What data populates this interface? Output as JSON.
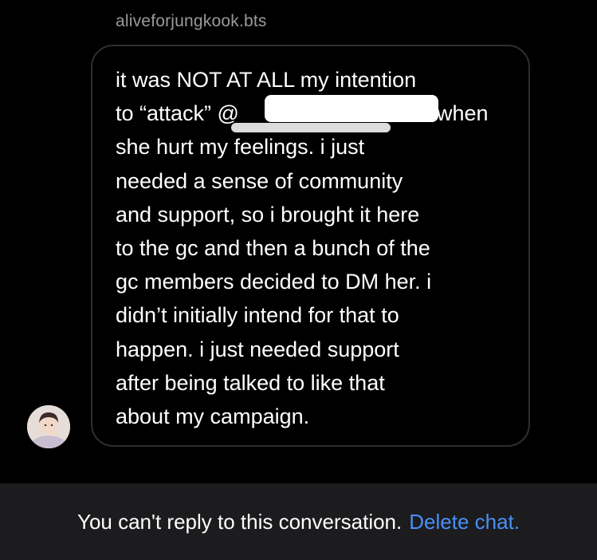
{
  "conversation": {
    "sender_name": "aliveforjungkook.bts"
  },
  "message": {
    "lines": [
      "it was NOT AT ALL my intention",
      "to “attack” @",
      "k when",
      "she hurt my feelings. i just",
      "needed a sense of community",
      "and support, so i brought it here",
      "to the gc and then a bunch of the",
      "gc members decided to DM her. i",
      "didn’t initially intend for that to",
      "happen. i just needed support",
      "after being talked to like that",
      "about my campaign."
    ]
  },
  "avatar": {
    "icon": "user-avatar-photo"
  },
  "footer": {
    "notice": "You can't reply to this conversation.",
    "action_label": "Delete chat."
  },
  "colors": {
    "background": "#000000",
    "bubble_border": "#2f2f2f",
    "footer_background": "#1c1c1e",
    "link": "#4a8ff7",
    "muted_text": "#9a9a9a"
  }
}
